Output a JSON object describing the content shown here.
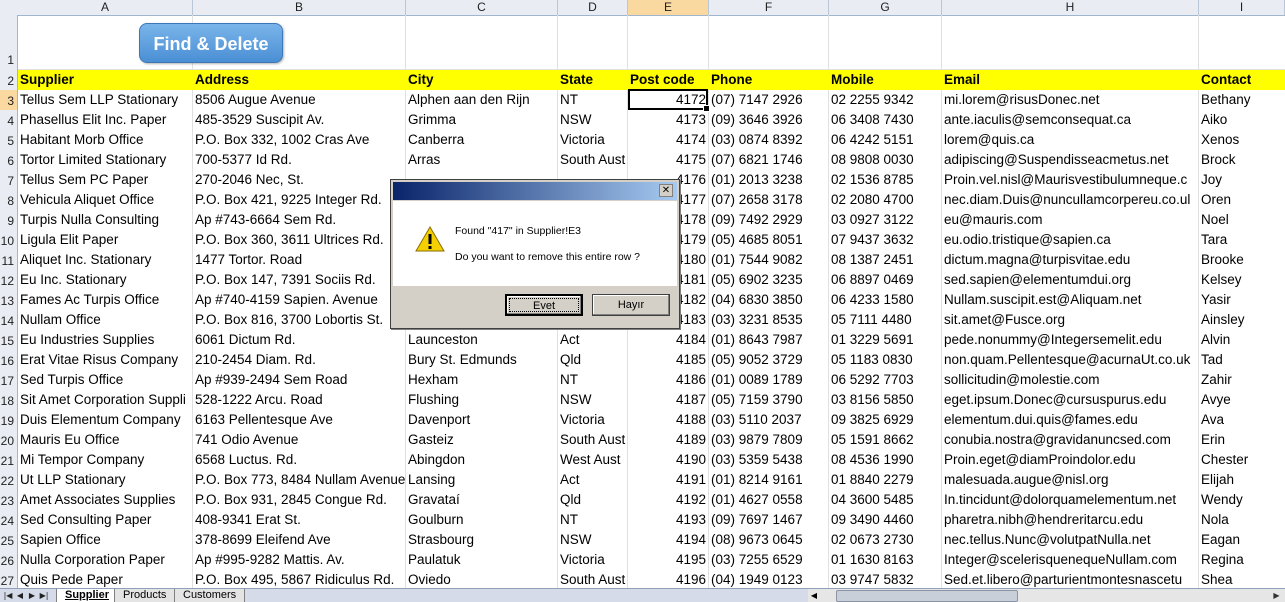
{
  "button": {
    "find_delete": "Find & Delete"
  },
  "columns": [
    "A",
    "B",
    "C",
    "D",
    "E",
    "F",
    "G",
    "H",
    "I"
  ],
  "header": [
    "Supplier",
    "Address",
    "City",
    "State",
    "Post code",
    "Phone",
    "Mobile",
    "Email",
    "Contact"
  ],
  "rows": [
    [
      "Tellus Sem LLP Stationary",
      "8506 Augue Avenue",
      "Alphen aan den Rijn",
      "NT",
      "4172",
      "(07) 7147 2926",
      "02 2255 9342",
      "mi.lorem@risusDonec.net",
      "Bethany"
    ],
    [
      "Phasellus Elit Inc. Paper",
      "485-3529 Suscipit Av.",
      "Grimma",
      "NSW",
      "4173",
      "(09) 3646 3926",
      "06 3408 7430",
      "ante.iaculis@semconsequat.ca",
      "Aiko"
    ],
    [
      "Habitant Morb Office",
      "P.O. Box 332, 1002 Cras Ave",
      "Canberra",
      "Victoria",
      "4174",
      "(03) 0874 8392",
      "06 4242 5151",
      "lorem@quis.ca",
      "Xenos"
    ],
    [
      "Tortor Limited Stationary",
      "700-5377 Id Rd.",
      "Arras",
      "South Aust",
      "4175",
      "(07) 6821 1746",
      "08 9808 0030",
      "adipiscing@Suspendisseacmetus.net",
      "Brock"
    ],
    [
      "Tellus Sem PC Paper",
      "270-2046 Nec, St.",
      "",
      "",
      "4176",
      "(01) 2013 3238",
      "02 1536 8785",
      "Proin.vel.nisl@Maurisvestibulumneque.c",
      "Joy"
    ],
    [
      "Vehicula Aliquet Office",
      "P.O. Box 421, 9225 Integer Rd.",
      "",
      "",
      "4177",
      "(07) 2658 3178",
      "02 2080 4700",
      "nec.diam.Duis@nuncullamcorpereu.co.ul",
      "Oren"
    ],
    [
      "Turpis Nulla Consulting",
      "Ap #743-6664 Sem Rd.",
      "",
      "",
      "4178",
      "(09) 7492 2929",
      "03 0927 3122",
      "eu@mauris.com",
      "Noel"
    ],
    [
      "Ligula Elit Paper",
      "P.O. Box 360, 3611 Ultrices Rd.",
      "",
      "",
      "4179",
      "(05) 4685 8051",
      "07 9437 3632",
      "eu.odio.tristique@sapien.ca",
      "Tara"
    ],
    [
      "Aliquet Inc. Stationary",
      "1477 Tortor. Road",
      "",
      "",
      "4180",
      "(01) 7544 9082",
      "08 1387 2451",
      "dictum.magna@turpisvitae.edu",
      "Brooke"
    ],
    [
      "Eu Inc. Stationary",
      "P.O. Box 147, 7391 Sociis Rd.",
      "",
      "",
      "4181",
      "(05) 6902 3235",
      "06 8897 0469",
      "sed.sapien@elementumdui.org",
      "Kelsey"
    ],
    [
      "Fames Ac Turpis  Office",
      "Ap #740-4159 Sapien. Avenue",
      "",
      "",
      "4182",
      "(04) 6830 3850",
      "06 4233 1580",
      "Nullam.suscipit.est@Aliquam.net",
      "Yasir"
    ],
    [
      "Nullam  Office",
      "P.O. Box 816, 3700 Lobortis St.",
      "",
      "",
      "4183",
      "(03) 3231 8535",
      "05 7111 4480",
      "sit.amet@Fusce.org",
      "Ainsley"
    ],
    [
      "Eu Industries Supplies",
      "6061 Dictum Rd.",
      "Launceston",
      "Act",
      "4184",
      "(01) 8643 7987",
      "01 3229 5691",
      "pede.nonummy@Integersemelit.edu",
      "Alvin"
    ],
    [
      "Erat Vitae Risus Company",
      "210-2454 Diam. Rd.",
      "Bury St. Edmunds",
      "Qld",
      "4185",
      "(05) 9052 3729",
      "05 1183 0830",
      "non.quam.Pellentesque@acurnaUt.co.uk",
      "Tad"
    ],
    [
      "Sed Turpis Office",
      "Ap #939-2494 Sem Road",
      "Hexham",
      "NT",
      "4186",
      "(01) 0089 1789",
      "06 5292 7703",
      "sollicitudin@molestie.com",
      "Zahir"
    ],
    [
      "Sit Amet Corporation Suppli",
      "528-1222 Arcu. Road",
      "Flushing",
      "NSW",
      "4187",
      "(05) 7159 3790",
      "03 8156 5850",
      "eget.ipsum.Donec@cursuspurus.edu",
      "Avye"
    ],
    [
      "Duis Elementum Company",
      "6163 Pellentesque Ave",
      "Davenport",
      "Victoria",
      "4188",
      "(03) 5110 2037",
      "09 3825 6929",
      "elementum.dui.quis@fames.edu",
      "Ava"
    ],
    [
      "Mauris Eu Office",
      "741 Odio Avenue",
      "Gasteiz",
      "South Aust",
      "4189",
      "(03) 9879 7809",
      "05 1591 8662",
      "conubia.nostra@gravidanuncsed.com",
      "Erin"
    ],
    [
      "Mi Tempor Company",
      "6568 Luctus. Rd.",
      "Abingdon",
      "West Aust",
      "4190",
      "(03) 5359 5438",
      "08 4536 1990",
      "Proin.eget@diamProindolor.edu",
      "Chester"
    ],
    [
      "Ut LLP Stationary",
      "P.O. Box 773, 8484 Nullam Avenue",
      "Lansing",
      "Act",
      "4191",
      "(01) 8214 9161",
      "01 8840 2279",
      "malesuada.augue@nisl.org",
      "Elijah"
    ],
    [
      "Amet Associates Supplies",
      "P.O. Box 931, 2845 Congue Rd.",
      "Gravataí",
      "Qld",
      "4192",
      "(01) 4627 0558",
      "04 3600 5485",
      "In.tincidunt@dolorquamelementum.net",
      "Wendy"
    ],
    [
      "Sed Consulting Paper",
      "408-9341 Erat St.",
      "Goulburn",
      "NT",
      "4193",
      "(09) 7697 1467",
      "09 3490 4460",
      "pharetra.nibh@hendreritarcu.edu",
      "Nola"
    ],
    [
      "Sapien  Office",
      "378-8699 Eleifend Ave",
      "Strasbourg",
      "NSW",
      "4194",
      "(08) 9673 0645",
      "02 0673 2730",
      "nec.tellus.Nunc@volutpatNulla.net",
      "Eagan"
    ],
    [
      "Nulla Corporation Paper",
      "Ap #995-9282 Mattis. Av.",
      "Paulatuk",
      "Victoria",
      "4195",
      "(03) 7255 6529",
      "01 1630 8163",
      "Integer@scelerisquenequeNullam.com",
      "Regina"
    ],
    [
      "Quis Pede  Paper",
      "P.O. Box 495, 5867 Ridiculus Rd.",
      "Oviedo",
      "South Aust",
      "4196",
      "(04) 1949 0123",
      "03 9747 5832",
      "Sed.et.libero@parturientmontesnascetu",
      "Shea"
    ]
  ],
  "dialog": {
    "message1": "Found \"417\" in Supplier!E3",
    "message2": "Do you want to remove this entire row ?",
    "yes_label": "Evet",
    "no_label": "Hayır",
    "close_glyph": "✕"
  },
  "tabs": [
    "Supplier",
    "Products",
    "Customers"
  ],
  "active_tab": "Supplier",
  "colors": {
    "header_fill": "#ffff00",
    "selected_header": "#f9d99f",
    "button_blue": "#5b9bd5",
    "dialog_title": "#0a246a"
  }
}
